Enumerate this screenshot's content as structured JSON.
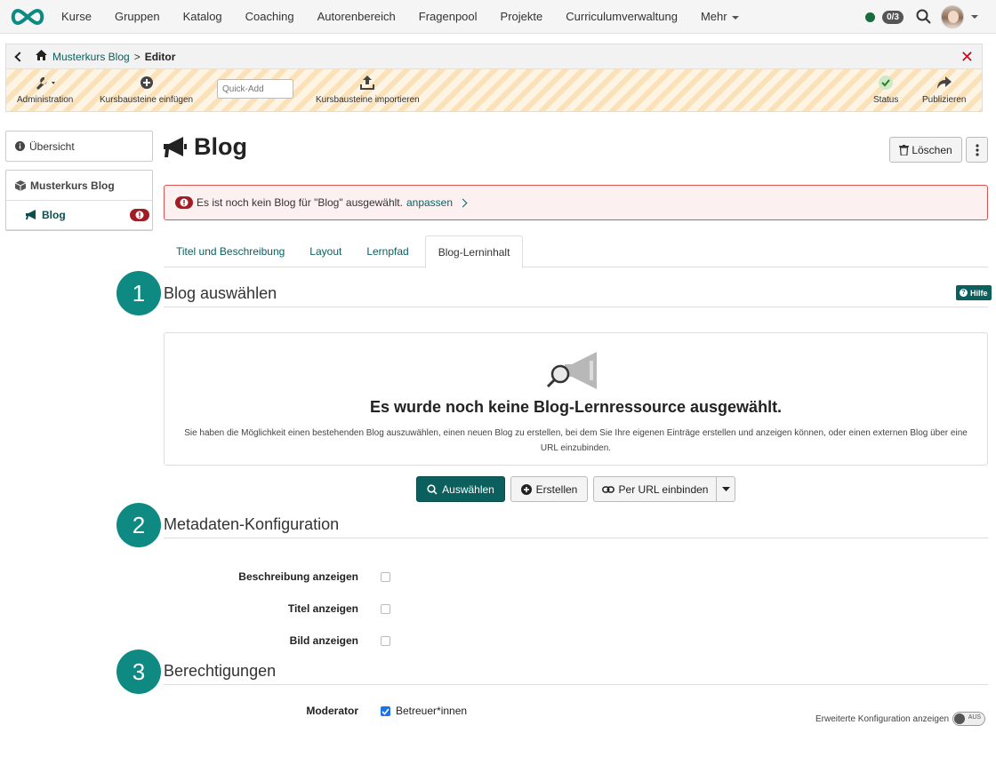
{
  "nav": {
    "items": [
      "Kurse",
      "Gruppen",
      "Katalog",
      "Coaching",
      "Autorenbereich",
      "Fragenpool",
      "Projekte",
      "Curriculumverwaltung"
    ],
    "more": "Mehr",
    "count": "0/3"
  },
  "editor": {
    "breadcrumb_course": "Musterkurs Blog",
    "breadcrumb_separator": ">",
    "breadcrumb_current": "Editor",
    "tools": {
      "administration": "Administration",
      "insert": "Kursbausteine einfügen",
      "quick_add_placeholder": "Quick-Add",
      "import": "Kursbausteine importieren",
      "status": "Status",
      "publish": "Publizieren"
    }
  },
  "sidebar": {
    "overview": "Übersicht",
    "course": "Musterkurs Blog",
    "node": "Blog"
  },
  "main": {
    "title": "Blog",
    "delete_label": "Löschen",
    "alert_text": "Es ist noch kein Blog für \"Blog\" ausgewählt.",
    "alert_link": "anpassen",
    "tabs": [
      "Titel und Beschreibung",
      "Layout",
      "Lernpfad",
      "Blog-Lerninhalt"
    ],
    "active_tab": "Blog-Lerninhalt",
    "help_label": "Hilfe"
  },
  "sections": [
    {
      "number": "1",
      "title": "Blog auswählen"
    },
    {
      "number": "2",
      "title": "Metadaten-Konfiguration"
    },
    {
      "number": "3",
      "title": "Berechtigungen"
    }
  ],
  "empty_state": {
    "title": "Es wurde noch keine Blog-Lernressource ausgewählt.",
    "description": "Sie haben die Möglichkeit einen bestehenden Blog auszuwählen, einen neuen Blog zu erstellen, bei dem Sie Ihre eigenen Einträge erstellen und anzeigen können, oder einen externen Blog über eine URL einzubinden."
  },
  "actions": {
    "select": "Auswählen",
    "create": "Erstellen",
    "embed_url": "Per URL einbinden"
  },
  "metadata": {
    "show_description": "Beschreibung anzeigen",
    "show_title": "Titel anzeigen",
    "show_image": "Bild anzeigen"
  },
  "permissions": {
    "moderator_label": "Moderator",
    "coaches_label": "Betreuer*innen",
    "coaches_checked": true
  },
  "advanced": {
    "label": "Erweiterte Konfiguration anzeigen",
    "toggle_label": "AUS"
  },
  "colors": {
    "primary": "#0b5f5d",
    "step_circle": "#0e8a83",
    "error": "#a11c23",
    "close": "#d0021b",
    "status_online": "#1a6b3d"
  }
}
